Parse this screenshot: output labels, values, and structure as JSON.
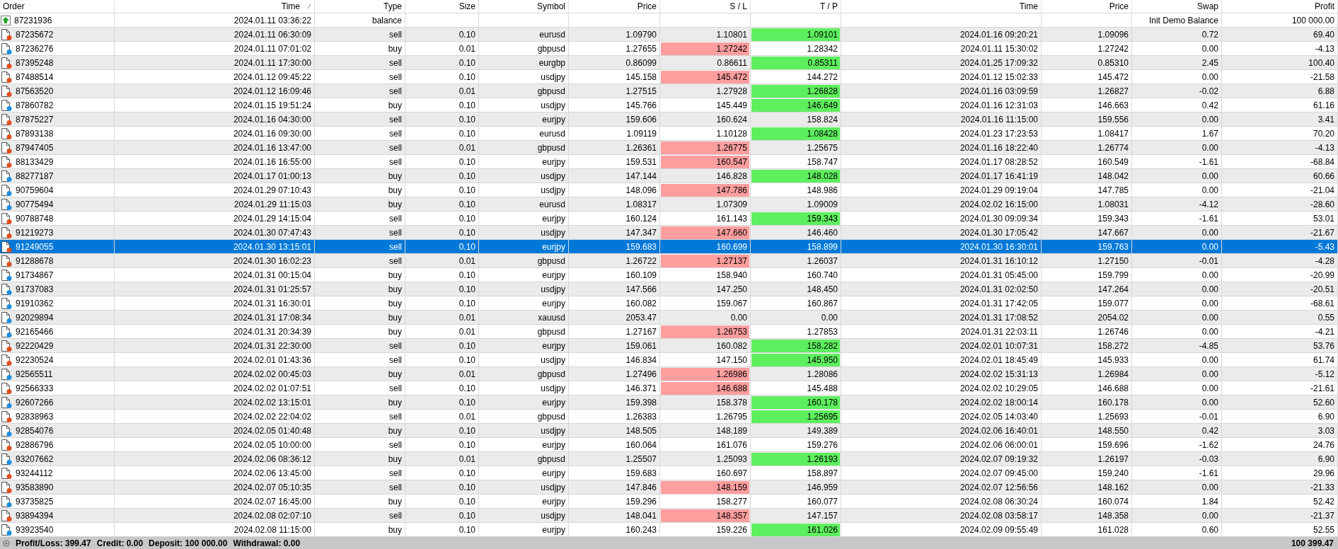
{
  "columns": [
    {
      "label": "Order",
      "sorted": false
    },
    {
      "label": "Time",
      "sorted": true
    },
    {
      "label": "Type",
      "sorted": false
    },
    {
      "label": "Size",
      "sorted": false
    },
    {
      "label": "Symbol",
      "sorted": false
    },
    {
      "label": "Price",
      "sorted": false
    },
    {
      "label": "S / L",
      "sorted": false
    },
    {
      "label": "T / P",
      "sorted": false
    },
    {
      "label": "Time",
      "sorted": false
    },
    {
      "label": "Price",
      "sorted": false
    },
    {
      "label": "Swap",
      "sorted": false
    },
    {
      "label": "Profit",
      "sorted": false
    }
  ],
  "rows": [
    {
      "kind": "balance",
      "selected": false,
      "order": "87231936",
      "time": "2024.01.11 03:36:22",
      "type": "balance",
      "comment": "Init Demo Balance",
      "profit": "100 000.00"
    },
    {
      "kind": "sell",
      "selected": false,
      "order": "87235672",
      "time": "2024.01.11 06:30:09",
      "type": "sell",
      "size": "0.10",
      "symbol": "eurusd",
      "price": "1.09790",
      "sl": "1.10801",
      "tp": "1.09101",
      "sl_hit": false,
      "tp_hit": true,
      "close_time": "2024.01.16 09:20:21",
      "close_price": "1.09096",
      "swap": "0.72",
      "profit": "69.40"
    },
    {
      "kind": "buy",
      "selected": false,
      "order": "87236276",
      "time": "2024.01.11 07:01:02",
      "type": "buy",
      "size": "0.01",
      "symbol": "gbpusd",
      "price": "1.27655",
      "sl": "1.27242",
      "tp": "1.28342",
      "sl_hit": true,
      "tp_hit": false,
      "close_time": "2024.01.11 15:30:02",
      "close_price": "1.27242",
      "swap": "0.00",
      "profit": "-4.13"
    },
    {
      "kind": "sell",
      "selected": false,
      "order": "87395248",
      "time": "2024.01.11 17:30:00",
      "type": "sell",
      "size": "0.10",
      "symbol": "eurgbp",
      "price": "0.86099",
      "sl": "0.86611",
      "tp": "0.85311",
      "sl_hit": false,
      "tp_hit": true,
      "close_time": "2024.01.25 17:09:32",
      "close_price": "0.85310",
      "swap": "2.45",
      "profit": "100.40"
    },
    {
      "kind": "sell",
      "selected": false,
      "order": "87488514",
      "time": "2024.01.12 09:45:22",
      "type": "sell",
      "size": "0.10",
      "symbol": "usdjpy",
      "price": "145.158",
      "sl": "145.472",
      "tp": "144.272",
      "sl_hit": true,
      "tp_hit": false,
      "close_time": "2024.01.12 15:02:33",
      "close_price": "145.472",
      "swap": "0.00",
      "profit": "-21.58"
    },
    {
      "kind": "sell",
      "selected": false,
      "order": "87563520",
      "time": "2024.01.12 16:09:46",
      "type": "sell",
      "size": "0.01",
      "symbol": "gbpusd",
      "price": "1.27515",
      "sl": "1.27928",
      "tp": "1.26828",
      "sl_hit": false,
      "tp_hit": true,
      "close_time": "2024.01.16 03:09:59",
      "close_price": "1.26827",
      "swap": "-0.02",
      "profit": "6.88"
    },
    {
      "kind": "buy",
      "selected": false,
      "order": "87860782",
      "time": "2024.01.15 19:51:24",
      "type": "buy",
      "size": "0.10",
      "symbol": "usdjpy",
      "price": "145.766",
      "sl": "145.449",
      "tp": "146.649",
      "sl_hit": false,
      "tp_hit": true,
      "close_time": "2024.01.16 12:31:03",
      "close_price": "146.663",
      "swap": "0.42",
      "profit": "61.16"
    },
    {
      "kind": "sell",
      "selected": false,
      "order": "87875227",
      "time": "2024.01.16 04:30:00",
      "type": "sell",
      "size": "0.10",
      "symbol": "eurjpy",
      "price": "159.606",
      "sl": "160.624",
      "tp": "158.824",
      "sl_hit": false,
      "tp_hit": false,
      "close_time": "2024.01.16 11:15:00",
      "close_price": "159.556",
      "swap": "0.00",
      "profit": "3.41"
    },
    {
      "kind": "sell",
      "selected": false,
      "order": "87893138",
      "time": "2024.01.16 09:30:00",
      "type": "sell",
      "size": "0.10",
      "symbol": "eurusd",
      "price": "1.09119",
      "sl": "1.10128",
      "tp": "1.08428",
      "sl_hit": false,
      "tp_hit": true,
      "close_time": "2024.01.23 17:23:53",
      "close_price": "1.08417",
      "swap": "1.67",
      "profit": "70.20"
    },
    {
      "kind": "sell",
      "selected": false,
      "order": "87947405",
      "time": "2024.01.16 13:47:00",
      "type": "sell",
      "size": "0.01",
      "symbol": "gbpusd",
      "price": "1.26361",
      "sl": "1.26775",
      "tp": "1.25675",
      "sl_hit": true,
      "tp_hit": false,
      "close_time": "2024.01.16 18:22:40",
      "close_price": "1.26774",
      "swap": "0.00",
      "profit": "-4.13"
    },
    {
      "kind": "sell",
      "selected": false,
      "order": "88133429",
      "time": "2024.01.16 16:55:00",
      "type": "sell",
      "size": "0.10",
      "symbol": "eurjpy",
      "price": "159.531",
      "sl": "160.547",
      "tp": "158.747",
      "sl_hit": true,
      "tp_hit": false,
      "close_time": "2024.01.17 08:28:52",
      "close_price": "160.549",
      "swap": "-1.61",
      "profit": "-68.84"
    },
    {
      "kind": "buy",
      "selected": false,
      "order": "88277187",
      "time": "2024.01.17 01:00:13",
      "type": "buy",
      "size": "0.10",
      "symbol": "usdjpy",
      "price": "147.144",
      "sl": "146.828",
      "tp": "148.028",
      "sl_hit": false,
      "tp_hit": true,
      "close_time": "2024.01.17 16:41:19",
      "close_price": "148.042",
      "swap": "0.00",
      "profit": "60.66"
    },
    {
      "kind": "buy",
      "selected": false,
      "order": "90759604",
      "time": "2024.01.29 07:10:43",
      "type": "buy",
      "size": "0.10",
      "symbol": "usdjpy",
      "price": "148.096",
      "sl": "147.786",
      "tp": "148.986",
      "sl_hit": true,
      "tp_hit": false,
      "close_time": "2024.01.29 09:19:04",
      "close_price": "147.785",
      "swap": "0.00",
      "profit": "-21.04"
    },
    {
      "kind": "buy",
      "selected": false,
      "order": "90775494",
      "time": "2024.01.29 11:15:03",
      "type": "buy",
      "size": "0.10",
      "symbol": "eurusd",
      "price": "1.08317",
      "sl": "1.07309",
      "tp": "1.09009",
      "sl_hit": false,
      "tp_hit": false,
      "close_time": "2024.02.02 16:15:00",
      "close_price": "1.08031",
      "swap": "-4.12",
      "profit": "-28.60"
    },
    {
      "kind": "sell",
      "selected": false,
      "order": "90788748",
      "time": "2024.01.29 14:15:04",
      "type": "sell",
      "size": "0.10",
      "symbol": "eurjpy",
      "price": "160.124",
      "sl": "161.143",
      "tp": "159.343",
      "sl_hit": false,
      "tp_hit": true,
      "close_time": "2024.01.30 09:09:34",
      "close_price": "159.343",
      "swap": "-1.61",
      "profit": "53.01"
    },
    {
      "kind": "sell",
      "selected": false,
      "order": "91219273",
      "time": "2024.01.30 07:47:43",
      "type": "sell",
      "size": "0.10",
      "symbol": "usdjpy",
      "price": "147.347",
      "sl": "147.660",
      "tp": "146.460",
      "sl_hit": true,
      "tp_hit": false,
      "close_time": "2024.01.30 17:05:42",
      "close_price": "147.667",
      "swap": "0.00",
      "profit": "-21.67"
    },
    {
      "kind": "sell",
      "selected": true,
      "order": "91249055",
      "time": "2024.01.30 13:15:01",
      "type": "sell",
      "size": "0.10",
      "symbol": "eurjpy",
      "price": "159.683",
      "sl": "160.699",
      "tp": "158.899",
      "close_time": "2024.01.30 16:30:01",
      "close_price": "159.763",
      "swap": "0.00",
      "profit": "-5.43"
    },
    {
      "kind": "sell",
      "selected": false,
      "order": "91288678",
      "time": "2024.01.30 16:02:23",
      "type": "sell",
      "size": "0.01",
      "symbol": "gbpusd",
      "price": "1.26722",
      "sl": "1.27137",
      "tp": "1.26037",
      "sl_hit": true,
      "tp_hit": false,
      "close_time": "2024.01.31 16:10:12",
      "close_price": "1.27150",
      "swap": "-0.01",
      "profit": "-4.28"
    },
    {
      "kind": "buy",
      "selected": false,
      "order": "91734867",
      "time": "2024.01.31 00:15:04",
      "type": "buy",
      "size": "0.10",
      "symbol": "eurjpy",
      "price": "160.109",
      "sl": "158.940",
      "tp": "160.740",
      "sl_hit": false,
      "tp_hit": false,
      "close_time": "2024.01.31 05:45:00",
      "close_price": "159.799",
      "swap": "0.00",
      "profit": "-20.99"
    },
    {
      "kind": "buy",
      "selected": false,
      "order": "91737083",
      "time": "2024.01.31 01:25:57",
      "type": "buy",
      "size": "0.10",
      "symbol": "usdjpy",
      "price": "147.566",
      "sl": "147.250",
      "tp": "148.450",
      "sl_hit": false,
      "tp_hit": false,
      "close_time": "2024.01.31 02:02:50",
      "close_price": "147.264",
      "swap": "0.00",
      "profit": "-20.51"
    },
    {
      "kind": "buy",
      "selected": false,
      "order": "91910362",
      "time": "2024.01.31 16:30:01",
      "type": "buy",
      "size": "0.10",
      "symbol": "eurjpy",
      "price": "160.082",
      "sl": "159.067",
      "tp": "160.867",
      "sl_hit": false,
      "tp_hit": false,
      "close_time": "2024.01.31 17:42:05",
      "close_price": "159.077",
      "swap": "0.00",
      "profit": "-68.61"
    },
    {
      "kind": "buy",
      "selected": false,
      "order": "92029894",
      "time": "2024.01.31 17:08:34",
      "type": "buy",
      "size": "0.01",
      "symbol": "xauusd",
      "price": "2053.47",
      "sl": "0.00",
      "tp": "0.00",
      "sl_hit": false,
      "tp_hit": false,
      "close_time": "2024.01.31 17:08:52",
      "close_price": "2054.02",
      "swap": "0.00",
      "profit": "0.55"
    },
    {
      "kind": "buy",
      "selected": false,
      "order": "92165466",
      "time": "2024.01.31 20:34:39",
      "type": "buy",
      "size": "0.01",
      "symbol": "gbpusd",
      "price": "1.27167",
      "sl": "1.26753",
      "tp": "1.27853",
      "sl_hit": true,
      "tp_hit": false,
      "close_time": "2024.01.31 22:03:11",
      "close_price": "1.26746",
      "swap": "0.00",
      "profit": "-4.21"
    },
    {
      "kind": "sell",
      "selected": false,
      "order": "92220429",
      "time": "2024.01.31 22:30:00",
      "type": "sell",
      "size": "0.10",
      "symbol": "eurjpy",
      "price": "159.061",
      "sl": "160.082",
      "tp": "158.282",
      "sl_hit": false,
      "tp_hit": true,
      "close_time": "2024.02.01 10:07:31",
      "close_price": "158.272",
      "swap": "-4.85",
      "profit": "53.76"
    },
    {
      "kind": "sell",
      "selected": false,
      "order": "92230524",
      "time": "2024.02.01 01:43:36",
      "type": "sell",
      "size": "0.10",
      "symbol": "usdjpy",
      "price": "146.834",
      "sl": "147.150",
      "tp": "145.950",
      "sl_hit": false,
      "tp_hit": true,
      "close_time": "2024.02.01 18:45:49",
      "close_price": "145.933",
      "swap": "0.00",
      "profit": "61.74"
    },
    {
      "kind": "buy",
      "selected": false,
      "order": "92565511",
      "time": "2024.02.02 00:45:03",
      "type": "buy",
      "size": "0.01",
      "symbol": "gbpusd",
      "price": "1.27496",
      "sl": "1.26986",
      "tp": "1.28086",
      "sl_hit": true,
      "tp_hit": false,
      "close_time": "2024.02.02 15:31:13",
      "close_price": "1.26984",
      "swap": "0.00",
      "profit": "-5.12"
    },
    {
      "kind": "sell",
      "selected": false,
      "order": "92566333",
      "time": "2024.02.02 01:07:51",
      "type": "sell",
      "size": "0.10",
      "symbol": "usdjpy",
      "price": "146.371",
      "sl": "146.688",
      "tp": "145.488",
      "sl_hit": true,
      "tp_hit": false,
      "close_time": "2024.02.02 10:29:05",
      "close_price": "146.688",
      "swap": "0.00",
      "profit": "-21.61"
    },
    {
      "kind": "buy",
      "selected": false,
      "order": "92607266",
      "time": "2024.02.02 13:15:01",
      "type": "buy",
      "size": "0.10",
      "symbol": "eurjpy",
      "price": "159.398",
      "sl": "158.378",
      "tp": "160.178",
      "sl_hit": false,
      "tp_hit": true,
      "close_time": "2024.02.02 18:00:14",
      "close_price": "160.178",
      "swap": "0.00",
      "profit": "52.60"
    },
    {
      "kind": "sell",
      "selected": false,
      "order": "92838963",
      "time": "2024.02.02 22:04:02",
      "type": "sell",
      "size": "0.01",
      "symbol": "gbpusd",
      "price": "1.26383",
      "sl": "1.26795",
      "tp": "1.25695",
      "sl_hit": false,
      "tp_hit": true,
      "close_time": "2024.02.05 14:03:40",
      "close_price": "1.25693",
      "swap": "-0.01",
      "profit": "6.90"
    },
    {
      "kind": "buy",
      "selected": false,
      "order": "92854076",
      "time": "2024.02.05 01:40:48",
      "type": "buy",
      "size": "0.10",
      "symbol": "usdjpy",
      "price": "148.505",
      "sl": "148.189",
      "tp": "149.389",
      "sl_hit": false,
      "tp_hit": false,
      "close_time": "2024.02.06 16:40:01",
      "close_price": "148.550",
      "swap": "0.42",
      "profit": "3.03"
    },
    {
      "kind": "sell",
      "selected": false,
      "order": "92886796",
      "time": "2024.02.05 10:00:00",
      "type": "sell",
      "size": "0.10",
      "symbol": "eurjpy",
      "price": "160.064",
      "sl": "161.076",
      "tp": "159.276",
      "sl_hit": false,
      "tp_hit": false,
      "close_time": "2024.02.06 06:00:01",
      "close_price": "159.696",
      "swap": "-1.62",
      "profit": "24.76"
    },
    {
      "kind": "buy",
      "selected": false,
      "order": "93207662",
      "time": "2024.02.06 08:36:12",
      "type": "buy",
      "size": "0.01",
      "symbol": "gbpusd",
      "price": "1.25507",
      "sl": "1.25093",
      "tp": "1.26193",
      "sl_hit": false,
      "tp_hit": true,
      "close_time": "2024.02.07 09:19:32",
      "close_price": "1.26197",
      "swap": "-0.03",
      "profit": "6.90"
    },
    {
      "kind": "sell",
      "selected": false,
      "order": "93244112",
      "time": "2024.02.06 13:45:00",
      "type": "sell",
      "size": "0.10",
      "symbol": "eurjpy",
      "price": "159.683",
      "sl": "160.697",
      "tp": "158.897",
      "sl_hit": false,
      "tp_hit": false,
      "close_time": "2024.02.07 09:45:00",
      "close_price": "159.240",
      "swap": "-1.61",
      "profit": "29.96"
    },
    {
      "kind": "sell",
      "selected": false,
      "order": "93583890",
      "time": "2024.02.07 05:10:35",
      "type": "sell",
      "size": "0.10",
      "symbol": "usdjpy",
      "price": "147.846",
      "sl": "148.159",
      "tp": "146.959",
      "sl_hit": true,
      "tp_hit": false,
      "close_time": "2024.02.07 12:56:56",
      "close_price": "148.162",
      "swap": "0.00",
      "profit": "-21.33"
    },
    {
      "kind": "buy",
      "selected": false,
      "order": "93735825",
      "time": "2024.02.07 16:45:00",
      "type": "buy",
      "size": "0.10",
      "symbol": "eurjpy",
      "price": "159.296",
      "sl": "158.277",
      "tp": "160.077",
      "sl_hit": false,
      "tp_hit": false,
      "close_time": "2024.02.08 06:30:24",
      "close_price": "160.074",
      "swap": "1.84",
      "profit": "52.42"
    },
    {
      "kind": "sell",
      "selected": false,
      "order": "93894394",
      "time": "2024.02.08 02:07:10",
      "type": "sell",
      "size": "0.10",
      "symbol": "usdjpy",
      "price": "148.041",
      "sl": "148.357",
      "tp": "147.157",
      "sl_hit": true,
      "tp_hit": false,
      "close_time": "2024.02.08 03:58:17",
      "close_price": "148.358",
      "swap": "0.00",
      "profit": "-21.37"
    },
    {
      "kind": "buy",
      "selected": false,
      "order": "93923540",
      "time": "2024.02.08 11:15:00",
      "type": "buy",
      "size": "0.10",
      "symbol": "eurjpy",
      "price": "160.243",
      "sl": "159.226",
      "tp": "161.026",
      "sl_hit": false,
      "tp_hit": true,
      "close_time": "2024.02.09 09:55:49",
      "close_price": "161.028",
      "swap": "0.60",
      "profit": "52.55"
    }
  ],
  "summary": {
    "items": [
      "Profit/Loss: 399.47",
      "Credit: 0.00",
      "Deposit: 100 000.00",
      "Withdrawal: 0.00"
    ],
    "total": "100 399.47"
  }
}
